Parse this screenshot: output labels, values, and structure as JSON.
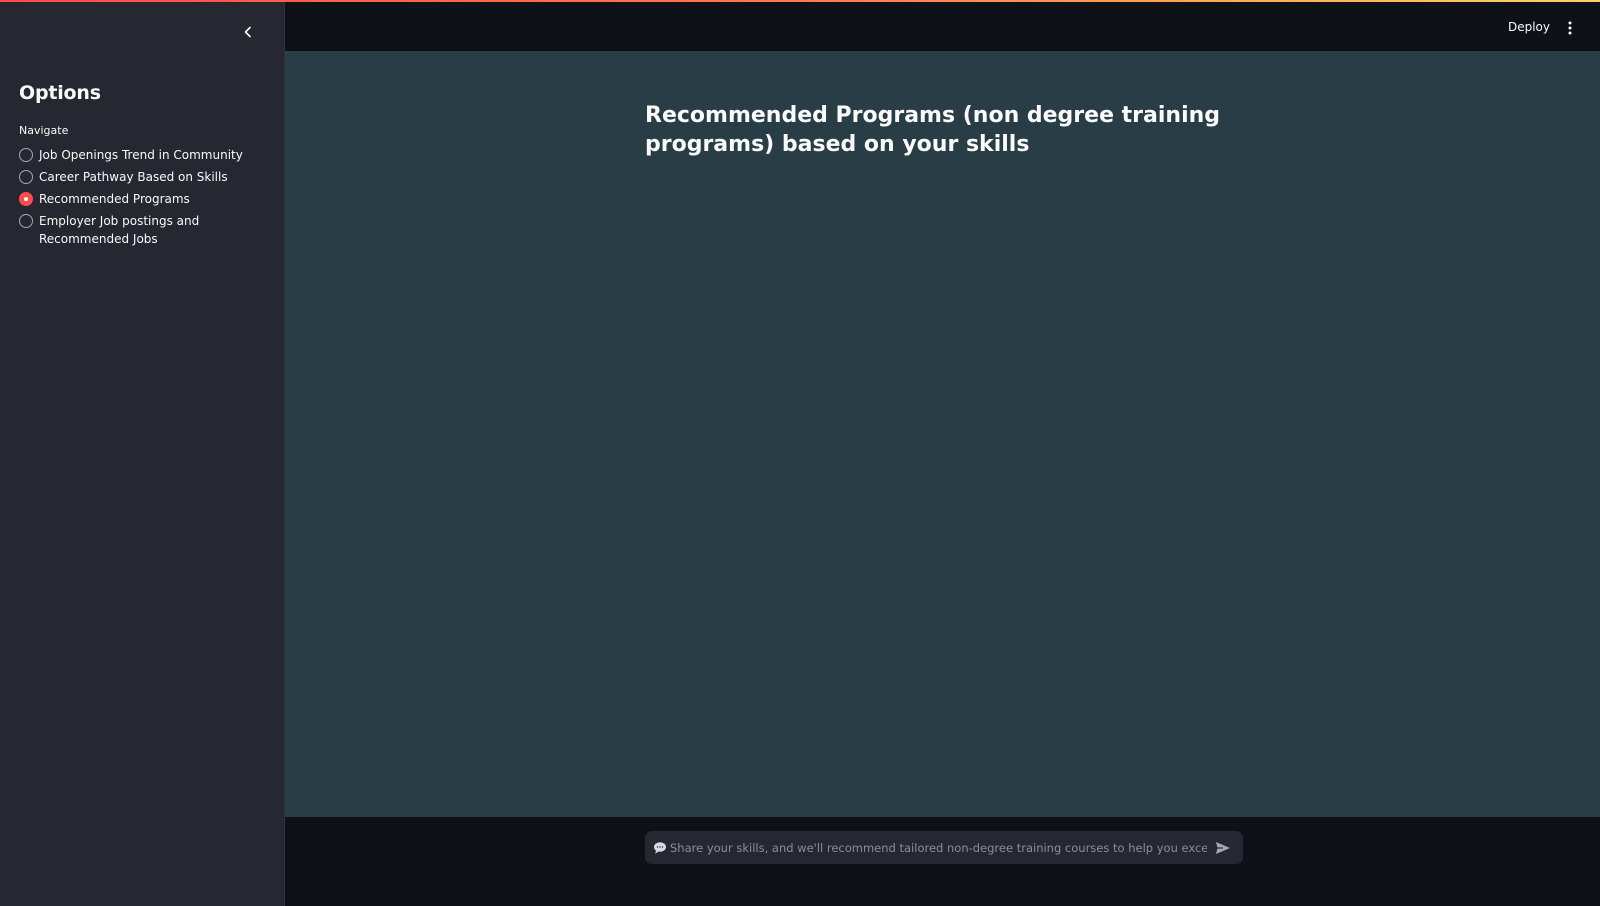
{
  "sidebar": {
    "title": "Options",
    "nav_label": "Navigate",
    "items": [
      {
        "label": "Job Openings Trend in Community",
        "selected": false
      },
      {
        "label": "Career Pathway Based on Skills",
        "selected": false
      },
      {
        "label": "Recommended Programs",
        "selected": true
      },
      {
        "label": "Employer Job postings and Recommended Jobs",
        "selected": false
      }
    ]
  },
  "header": {
    "deploy_label": "Deploy"
  },
  "main": {
    "title": "Recommended Programs (non degree training programs) based on your skills"
  },
  "chat": {
    "placeholder": "Share your skills, and we'll recommend tailored non-degree training courses to help you excel."
  },
  "colors": {
    "accent": "#ff4b4b",
    "sidebar_bg": "#262730",
    "main_bg": "#283d46",
    "header_bg": "#0e1117"
  },
  "icons": [
    "chevron-left-icon",
    "kebab-menu-icon",
    "speech-bubble-icon",
    "send-icon"
  ]
}
